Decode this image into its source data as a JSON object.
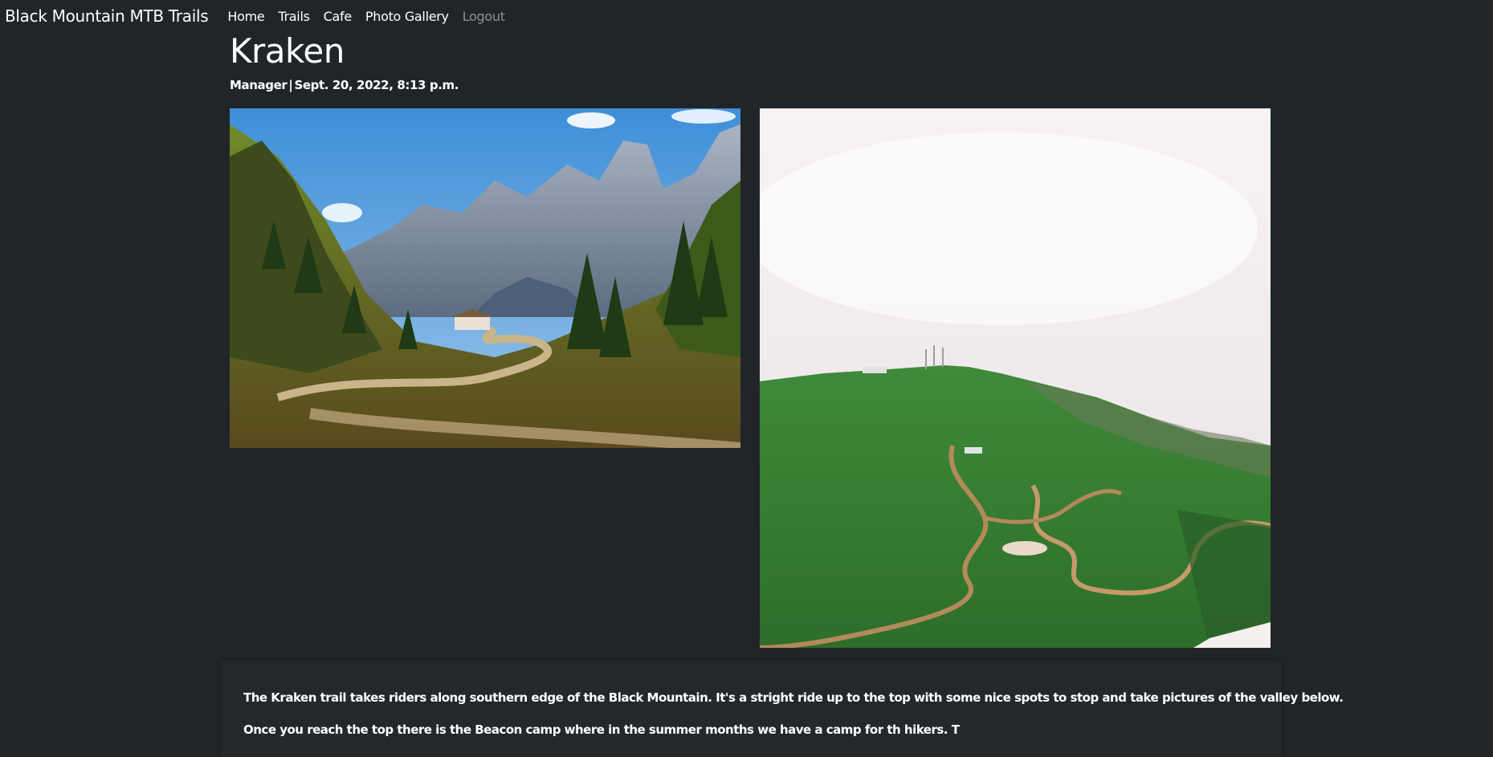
{
  "navbar": {
    "brand": "Black Mountain MTB Trails",
    "links": [
      {
        "label": "Home"
      },
      {
        "label": "Trails"
      },
      {
        "label": "Cafe"
      },
      {
        "label": "Photo Gallery"
      },
      {
        "label": "Logout"
      }
    ]
  },
  "post": {
    "title": "Kraken",
    "author": "Manager",
    "separator": "|",
    "date": "Sept. 20, 2022, 8:13 p.m.",
    "images": [
      {
        "icon": "mountain-valley-photo"
      },
      {
        "icon": "green-hillside-photo"
      }
    ],
    "paragraphs": [
      "The Kraken trail takes riders along southern edge of the Black Mountain. It's a stright ride up to the top with some nice spots to stop and take pictures of the valley below.",
      "Once you reach the top there is the Beacon camp where in the summer months we have a camp for th hikers. T"
    ]
  },
  "colors": {
    "background": "#212529",
    "text": "#ffffff",
    "muted_link": "#8c9196"
  }
}
